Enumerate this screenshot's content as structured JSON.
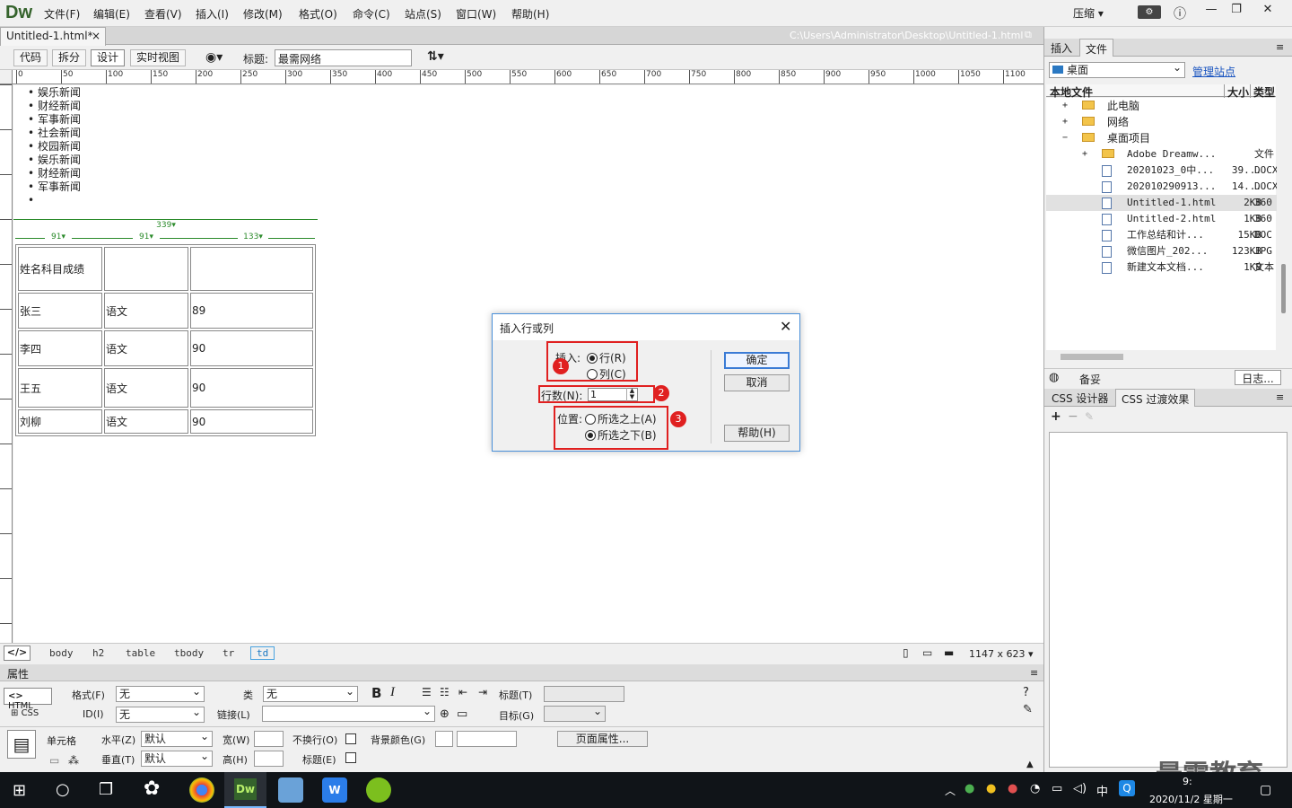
{
  "app": {
    "logo": "Dw"
  },
  "menu": [
    "文件(F)",
    "编辑(E)",
    "查看(V)",
    "插入(I)",
    "修改(M)",
    "格式(O)",
    "命令(C)",
    "站点(S)",
    "窗口(W)",
    "帮助(H)"
  ],
  "window": {
    "compress_label": "压缩",
    "minimize": "—",
    "maximize": "❐",
    "close": "✕"
  },
  "document": {
    "tab_label": "Untitled-1.html*",
    "tab_close": "×",
    "path": "C:\\Users\\Administrator\\Desktop\\Untitled-1.html"
  },
  "toolbar": {
    "views": [
      "代码",
      "拆分",
      "设计",
      "实时视图"
    ],
    "active_view": "设计",
    "title_label": "标题:",
    "title_value": "最需网络"
  },
  "ruler": {
    "h_ticks": [
      "0",
      "50",
      "100",
      "150",
      "200",
      "250",
      "300",
      "350",
      "400",
      "450",
      "500",
      "550",
      "600",
      "650",
      "700",
      "750",
      "800",
      "850",
      "900",
      "950",
      "1000",
      "1050",
      "1100"
    ]
  },
  "news_list": [
    "娱乐新闻",
    "财经新闻",
    "军事新闻",
    "社会新闻",
    "校园新闻",
    "娱乐新闻",
    "财经新闻",
    "军事新闻",
    ""
  ],
  "table": {
    "total_width": "339",
    "col_widths": [
      "91",
      "91",
      "133"
    ],
    "rows": [
      [
        "姓名科目成绩",
        "",
        ""
      ],
      [
        "张三",
        "语文",
        "89"
      ],
      [
        "李四",
        "语文",
        "90"
      ],
      [
        "王五",
        "语文",
        "90"
      ],
      [
        "刘柳",
        "语文",
        "90"
      ]
    ]
  },
  "dialog": {
    "title": "插入行或列",
    "close": "✕",
    "insert_label": "插入:",
    "opt_row": "行(R)",
    "opt_col": "列(C)",
    "count_label": "行数(N):",
    "count_value": "1",
    "position_label": "位置:",
    "opt_above": "所选之上(A)",
    "opt_below": "所选之下(B)",
    "ok": "确定",
    "cancel": "取消",
    "help": "帮助(H)",
    "badges": [
      "1",
      "2",
      "3"
    ],
    "selected_insert": "行(R)",
    "selected_position": "所选之下(B)"
  },
  "tagbar": {
    "tags": [
      "body",
      "h2",
      "table",
      "tbody",
      "tr",
      "td"
    ],
    "active_tag": "td",
    "size_text": "1147 x 623"
  },
  "properties": {
    "header": "属性",
    "html_btn": "HTML",
    "css_btn": "CSS",
    "format_label": "格式(F)",
    "format_value": "无",
    "class_label": "类",
    "class_value": "无",
    "bold": "B",
    "italic": "I",
    "title_label": "标题(T)",
    "id_label": "ID(I)",
    "id_value": "无",
    "link_label": "链接(L)",
    "target_label": "目标(G)",
    "cell_label": "单元格",
    "halign_label": "水平(Z)",
    "halign_value": "默认",
    "valign_label": "垂直(T)",
    "valign_value": "默认",
    "width_label": "宽(W)",
    "height_label": "高(H)",
    "nowrap_label": "不换行(O)",
    "header_label": "标题(E)",
    "bgcolor_label": "背景颜色(G)",
    "page_props": "页面属性..."
  },
  "rpanel": {
    "tabs": [
      "插入",
      "文件"
    ],
    "active_tab": "文件",
    "site_select": "桌面",
    "manage_link": "管理站点",
    "columns": [
      "本地文件",
      "大小",
      "类型"
    ],
    "tree": [
      {
        "name": "此电脑",
        "size": "",
        "type": "",
        "level": 1,
        "expander": "+"
      },
      {
        "name": "网络",
        "size": "",
        "type": "",
        "level": 1,
        "expander": "+"
      },
      {
        "name": "桌面项目",
        "size": "",
        "type": "",
        "level": 1,
        "expander": "−"
      },
      {
        "name": "Adobe Dreamw...",
        "size": "",
        "type": "文件",
        "level": 2,
        "expander": "+"
      },
      {
        "name": "20201023_0中...",
        "size": "39...",
        "type": "DOCX",
        "level": 2,
        "expander": ""
      },
      {
        "name": "202010290913...",
        "size": "14...",
        "type": "DOCX",
        "level": 2,
        "expander": ""
      },
      {
        "name": "Untitled-1.html",
        "size": "2KB",
        "type": "360",
        "level": 2,
        "expander": "",
        "selected": true
      },
      {
        "name": "Untitled-2.html",
        "size": "1KB",
        "type": "360",
        "level": 2,
        "expander": ""
      },
      {
        "name": "工作总结和计...",
        "size": "15KB",
        "type": "DOC",
        "level": 2,
        "expander": ""
      },
      {
        "name": "微信图片_202...",
        "size": "123KB",
        "type": "JPG",
        "level": 2,
        "expander": ""
      },
      {
        "name": "新建文本文档...",
        "size": "1KB",
        "type": "文本",
        "level": 2,
        "expander": ""
      }
    ],
    "backup_label": "备妥",
    "log_btn": "日志...",
    "css_tabs": [
      "CSS 设计器",
      "CSS 过渡效果"
    ],
    "css_active": "CSS 过渡效果",
    "css_add": "+",
    "css_remove": "−"
  },
  "taskbar": {
    "ime": "中",
    "time": "9:",
    "date": "2020/11/2 星期一",
    "dw_icon": "Dw"
  },
  "watermark": "最需教育"
}
